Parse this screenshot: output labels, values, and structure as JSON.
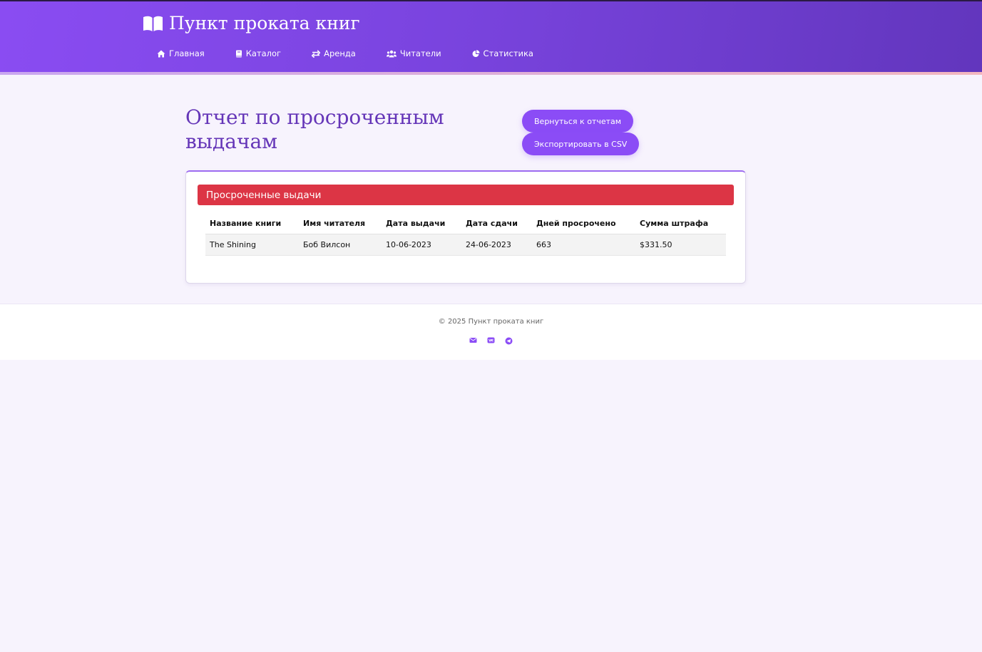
{
  "app": {
    "title": "Пункт проката книг",
    "brand_icon": "book-open-icon"
  },
  "nav": {
    "items": [
      {
        "label": "Главная",
        "icon": "home-icon"
      },
      {
        "label": "Каталог",
        "icon": "book-icon"
      },
      {
        "label": "Аренда",
        "icon": "exchange-icon"
      },
      {
        "label": "Читатели",
        "icon": "users-icon"
      },
      {
        "label": "Статистика",
        "icon": "pie-chart-icon"
      }
    ]
  },
  "page": {
    "title": "Отчет по просроченным выдачам",
    "back_button": "Вернуться к отчетам",
    "export_button": "Экспортировать в CSV"
  },
  "report": {
    "card_title": "Просроченные выдачи",
    "columns": [
      "Название книги",
      "Имя читателя",
      "Дата выдачи",
      "Дата сдачи",
      "Дней просрочено",
      "Сумма штрафа"
    ],
    "rows": [
      [
        "The Shining",
        "Боб Вилсон",
        "10-06-2023",
        "24-06-2023",
        "663",
        "$331.50"
      ]
    ]
  },
  "footer": {
    "copyright": "© 2025 Пункт проката книг",
    "social": [
      "envelope-icon",
      "vk-icon",
      "telegram-icon"
    ]
  },
  "colors": {
    "accent": "#8b4cf6",
    "header_start": "#8a4cf2",
    "header_end": "#6236bd",
    "title": "#6536b8",
    "danger": "#dc3545",
    "background": "#f7f3fd"
  }
}
